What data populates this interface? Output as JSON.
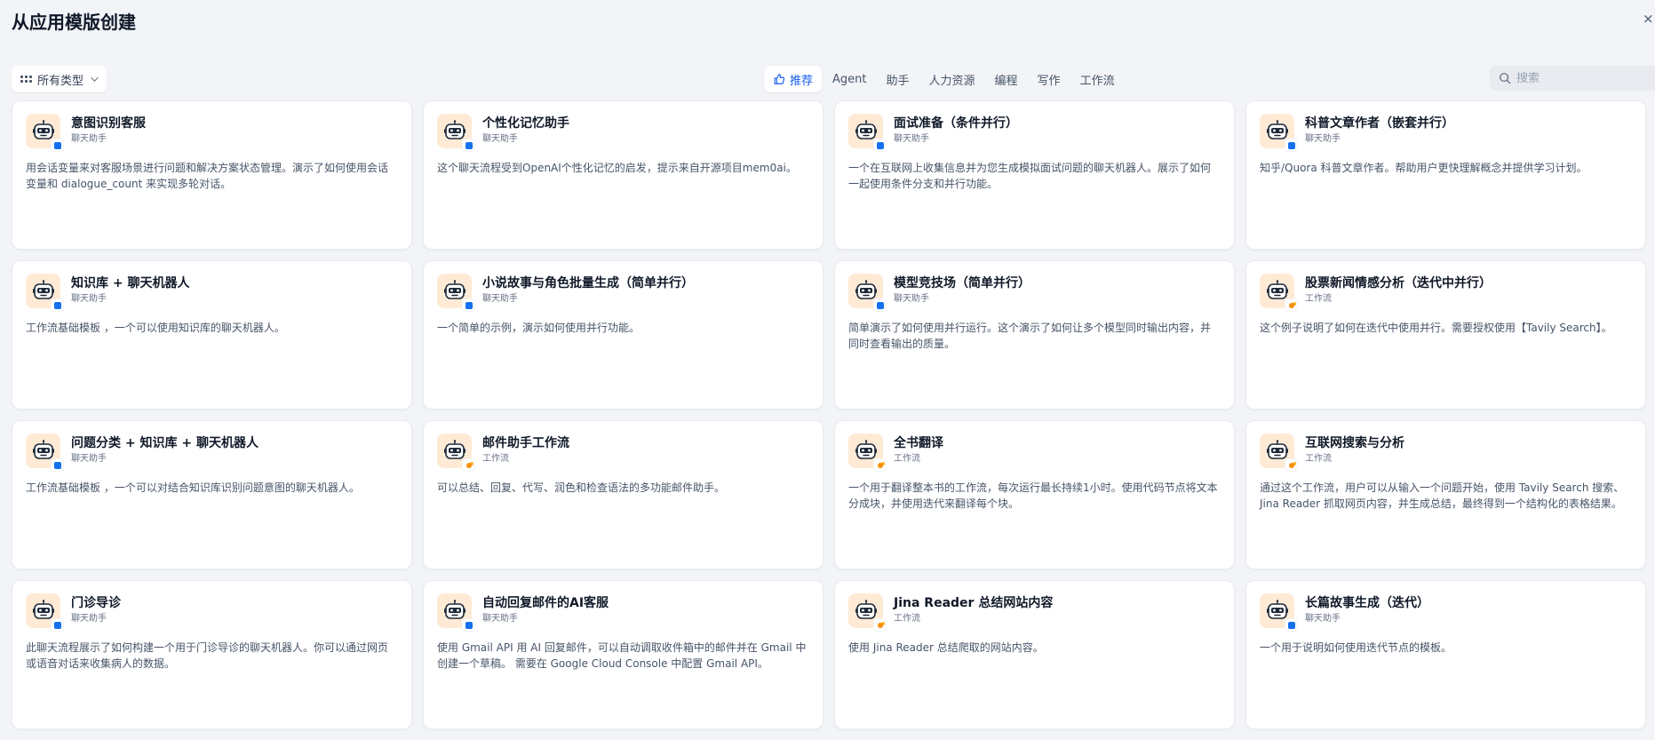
{
  "header": {
    "title": "从应用模版创建",
    "close_label": "×"
  },
  "type_filter": {
    "label": "所有类型",
    "icon": "grid-icon"
  },
  "tabs": [
    {
      "label": "推荐",
      "icon": "thumbs-up-icon",
      "active": true
    },
    {
      "label": "Agent"
    },
    {
      "label": "助手"
    },
    {
      "label": "人力资源"
    },
    {
      "label": "编程"
    },
    {
      "label": "写作"
    },
    {
      "label": "工作流"
    }
  ],
  "search": {
    "placeholder": "搜索",
    "icon": "search-icon"
  },
  "colors": {
    "accent": "#155eef",
    "icon_bg": "#ffead5",
    "chat_badge": "#1570ef",
    "workflow_badge": "#f79009"
  },
  "cards": [
    {
      "title": "意图识别客服",
      "type": "聊天助手",
      "kind": "chat",
      "desc": "用会话变量来对客服场景进行问题和解决方案状态管理。演示了如何使用会话变量和 dialogue_count 来实现多轮对话。"
    },
    {
      "title": "个性化记忆助手",
      "type": "聊天助手",
      "kind": "chat",
      "desc": "这个聊天流程受到OpenAI个性化记忆的启发，提示来自开源项目mem0ai。"
    },
    {
      "title": "面试准备（条件并行）",
      "type": "聊天助手",
      "kind": "chat",
      "desc": "一个在互联网上收集信息并为您生成模拟面试问题的聊天机器人。展示了如何一起使用条件分支和并行功能。"
    },
    {
      "title": "科普文章作者（嵌套并行）",
      "type": "聊天助手",
      "kind": "chat",
      "desc": "知乎/Quora 科普文章作者。帮助用户更快理解概念并提供学习计划。"
    },
    {
      "title": "知识库 + 聊天机器人",
      "type": "聊天助手",
      "kind": "chat",
      "desc": "工作流基础模板 ，一个可以使用知识库的聊天机器人。"
    },
    {
      "title": "小说故事与角色批量生成（简单并行）",
      "type": "聊天助手",
      "kind": "chat",
      "desc": "一个简单的示例，演示如何使用并行功能。"
    },
    {
      "title": "模型竞技场（简单并行）",
      "type": "聊天助手",
      "kind": "chat",
      "desc": "简单演示了如何使用并行运行。这个演示了如何让多个模型同时输出内容，并同时查看输出的质量。"
    },
    {
      "title": "股票新闻情感分析（迭代中并行）",
      "type": "工作流",
      "kind": "workflow",
      "desc": "这个例子说明了如何在迭代中使用并行。需要授权使用【Tavily Search】。"
    },
    {
      "title": "问题分类 + 知识库 + 聊天机器人",
      "type": "聊天助手",
      "kind": "chat",
      "desc": "工作流基础模板 ，一个可以对结合知识库识别问题意图的聊天机器人。"
    },
    {
      "title": "邮件助手工作流",
      "type": "工作流",
      "kind": "workflow",
      "desc": "可以总结、回复、代写、润色和检查语法的多功能邮件助手。"
    },
    {
      "title": "全书翻译",
      "type": "工作流",
      "kind": "workflow",
      "desc": "一个用于翻译整本书的工作流，每次运行最长持续1小时。使用代码节点将文本分成块，并使用迭代来翻译每个块。"
    },
    {
      "title": "互联网搜索与分析",
      "type": "工作流",
      "kind": "workflow",
      "desc": "通过这个工作流，用户可以从输入一个问题开始，使用 Tavily Search 搜索、Jina Reader 抓取网页内容，并生成总结，最终得到一个结构化的表格结果。"
    },
    {
      "title": "门诊导诊",
      "type": "聊天助手",
      "kind": "chat",
      "desc": "此聊天流程展示了如何构建一个用于门诊导诊的聊天机器人。你可以通过网页或语音对话来收集病人的数据。"
    },
    {
      "title": "自动回复邮件的AI客服",
      "type": "聊天助手",
      "kind": "chat",
      "desc": "使用 Gmail API 用 AI 回复邮件，可以自动调取收件箱中的邮件并在 Gmail 中创建一个草稿。 需要在 Google Cloud Console 中配置 Gmail API。"
    },
    {
      "title": "Jina Reader 总结网站内容",
      "type": "工作流",
      "kind": "workflow",
      "desc": "使用 Jina Reader 总结爬取的网站内容。"
    },
    {
      "title": "长篇故事生成（迭代）",
      "type": "聊天助手",
      "kind": "chat",
      "desc": "一个用于说明如何使用迭代节点的模板。"
    }
  ]
}
